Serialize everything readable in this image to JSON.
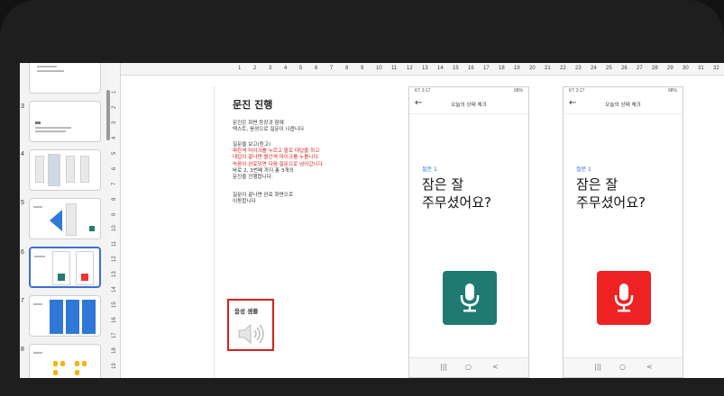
{
  "thumbnails": [
    {
      "num": ""
    },
    {
      "num": "3"
    },
    {
      "num": "4"
    },
    {
      "num": "5"
    },
    {
      "num": "6"
    },
    {
      "num": "7"
    },
    {
      "num": "8"
    }
  ],
  "h_ruler": [
    "1",
    "2",
    "3",
    "4",
    "5",
    "6",
    "7",
    "8",
    "9",
    "10",
    "11",
    "12",
    "13",
    "14",
    "15",
    "16",
    "17",
    "18",
    "19",
    "20",
    "21",
    "22",
    "23",
    "24",
    "25",
    "26",
    "27",
    "28",
    "29",
    "30",
    "31",
    "32"
  ],
  "v_ruler": [
    "1",
    "2",
    "3",
    "4",
    "5",
    "6",
    "7",
    "8",
    "9",
    "10",
    "11",
    "12",
    "13",
    "14",
    "15",
    "16",
    "17",
    "18",
    "19"
  ],
  "slide": {
    "title": "문진 진행",
    "para1_line1": "문진은 화면 등장과 함께",
    "para1_line2": "텍스트, 음성으로 질문이 나옵니다",
    "para2_line1": "질문을 보고(듣고)",
    "para2_red1": "파란색 마이크를 누르고 말로 대답을 하고",
    "para2_red2": "대답이 끝나면 빨간색 마이크를 누릅니다.",
    "para2_red3": "녹음이 완료되면 다음 질문으로 넘어갑니다",
    "para2_line5": "바로 2, 3번째 까지 총 3개의",
    "para2_line6": "문진을 진행합니다.",
    "para3_line1": "질문이 끝나면 완료 화면으로",
    "para3_line2": "이동합니다",
    "voice_label": "음성 샘플"
  },
  "phones": [
    {
      "status_time": "KT 3:17",
      "status_right": "98%",
      "title": "오늘의 상태 체크",
      "question_label": "질문 1",
      "question_line1": "잠은 잘",
      "question_line2": "주무셨어요?",
      "mic_color": "#1f7a72"
    },
    {
      "status_time": "KT 3:17",
      "status_right": "98%",
      "title": "오늘의 상태 체크",
      "question_label": "질문 1",
      "question_line1": "잠은 잘",
      "question_line2": "주무셨어요?",
      "mic_color": "#ee2222"
    }
  ],
  "nav": {
    "recent": "|||",
    "home": "○",
    "back": "<"
  },
  "icons": {
    "back": "arrow-left-icon",
    "mic": "microphone-icon",
    "speaker": "speaker-icon"
  }
}
